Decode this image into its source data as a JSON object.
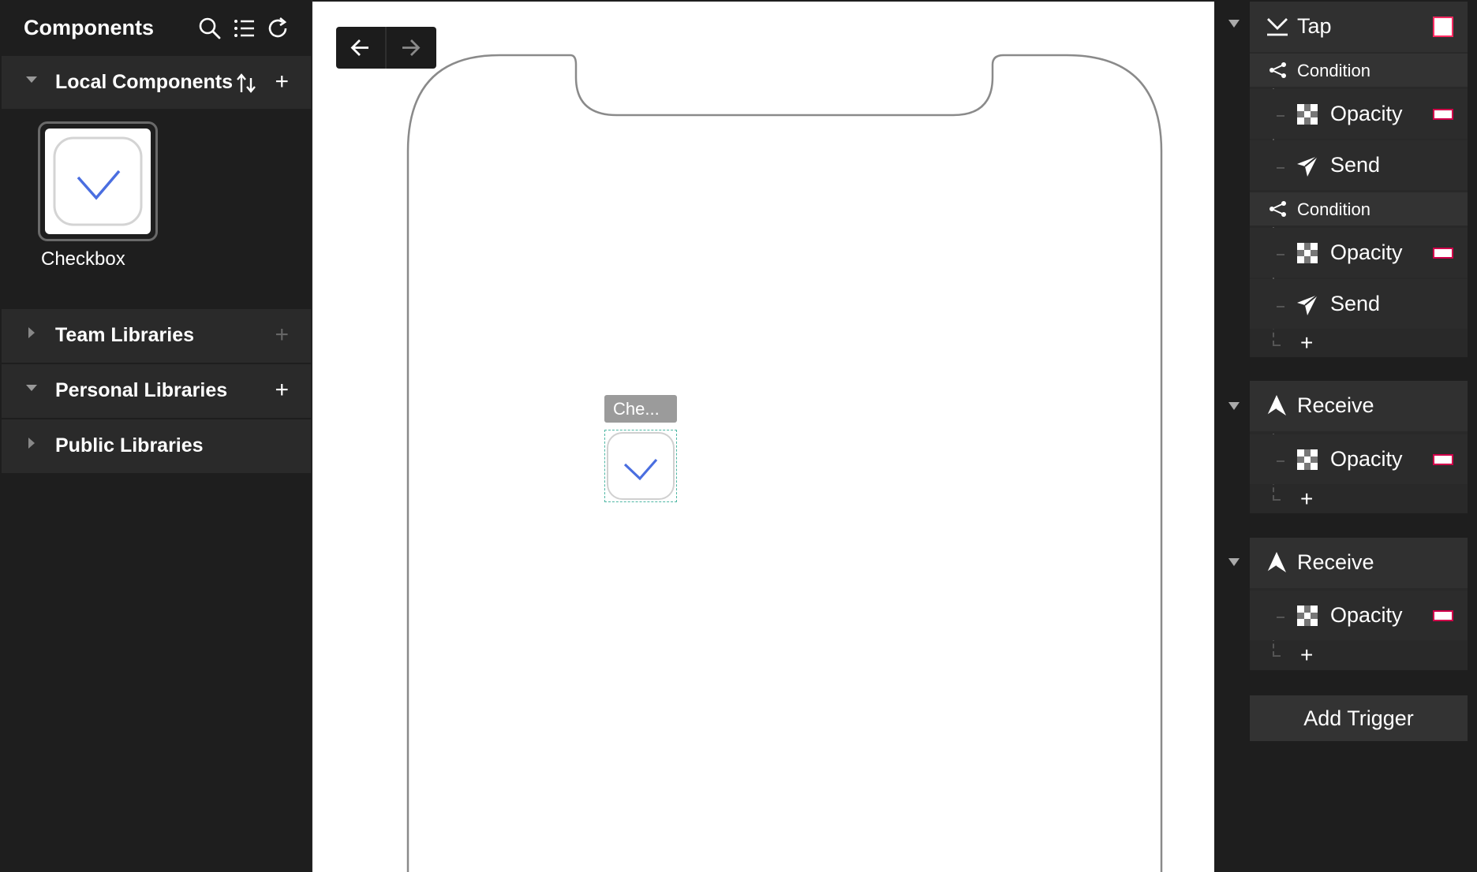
{
  "sidebar": {
    "title": "Components",
    "sections": {
      "local": {
        "label": "Local Components"
      },
      "team": {
        "label": "Team Libraries"
      },
      "personal": {
        "label": "Personal Libraries"
      },
      "public": {
        "label": "Public Libraries"
      }
    },
    "components": [
      {
        "label": "Checkbox"
      }
    ]
  },
  "canvas": {
    "chip_label": "Che...",
    "icons": {
      "back": "arrow-left-icon",
      "forward": "arrow-right-icon"
    }
  },
  "interactions": {
    "tap": {
      "label": "Tap",
      "conditions": [
        {
          "label": "Condition",
          "actions": [
            {
              "label": "Opacity"
            },
            {
              "label": "Send"
            }
          ]
        },
        {
          "label": "Condition",
          "actions": [
            {
              "label": "Opacity"
            },
            {
              "label": "Send"
            }
          ]
        }
      ]
    },
    "receives": [
      {
        "label": "Receive",
        "actions": [
          {
            "label": "Opacity"
          }
        ]
      },
      {
        "label": "Receive",
        "actions": [
          {
            "label": "Opacity"
          }
        ]
      }
    ],
    "add_trigger_label": "Add Trigger"
  },
  "colors": {
    "accent": "#4a6ee0",
    "swatch_border": "#d0004a"
  }
}
